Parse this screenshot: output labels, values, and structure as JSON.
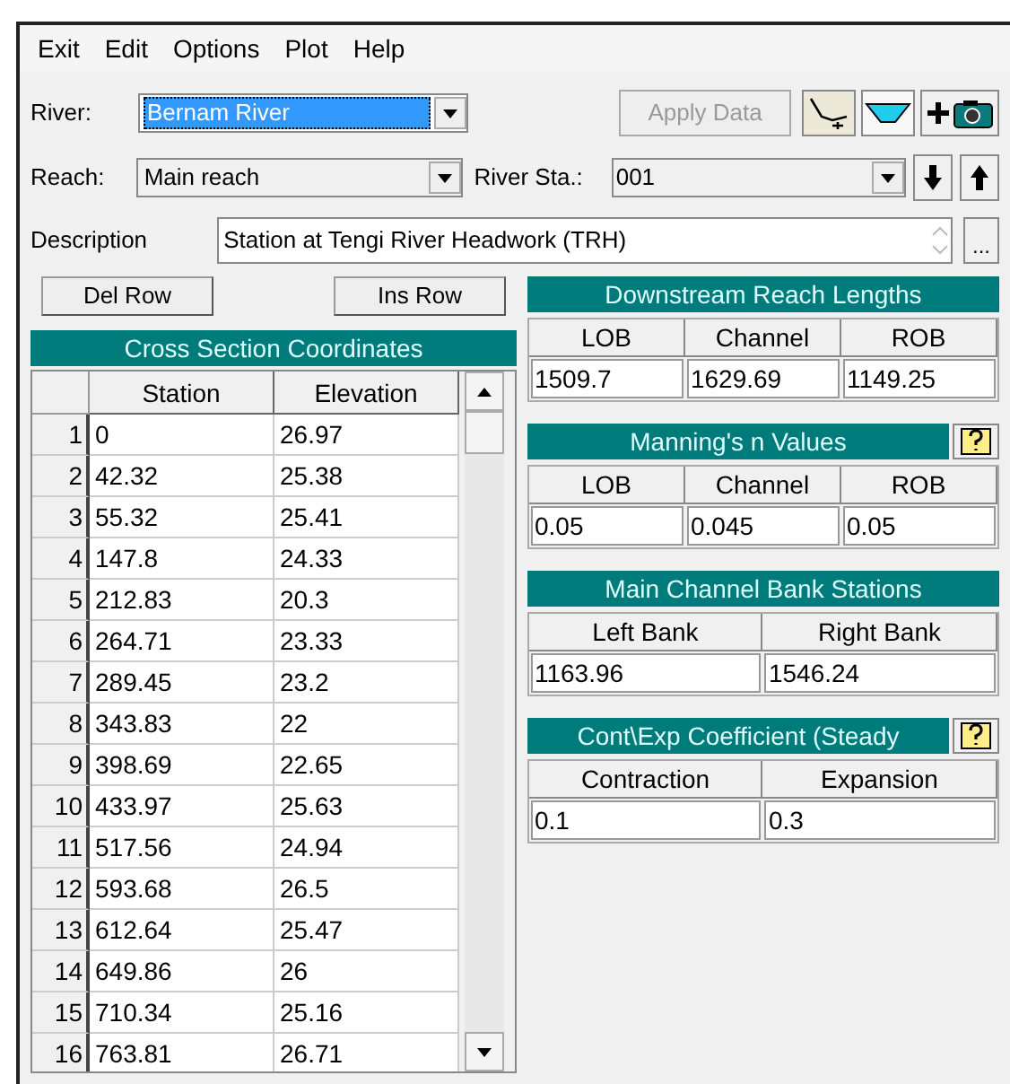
{
  "menu": [
    "Exit",
    "Edit",
    "Options",
    "Plot",
    "Help"
  ],
  "river": {
    "label": "River:",
    "value": "Bernam River"
  },
  "apply_button": {
    "label": "Apply Data",
    "disabled": true
  },
  "reach": {
    "label": "Reach:",
    "value": "Main reach"
  },
  "river_station": {
    "label": "River Sta.:",
    "value": "001"
  },
  "description": {
    "label": "Description",
    "value": "Station at Tengi River Headwork (TRH)",
    "more_button": "..."
  },
  "del_row": "Del Row",
  "ins_row": "Ins Row",
  "coordinates": {
    "title": "Cross Section Coordinates",
    "columns": [
      "Station",
      "Elevation"
    ],
    "rows": [
      {
        "n": "1",
        "station": "0",
        "elevation": "26.97"
      },
      {
        "n": "2",
        "station": "42.32",
        "elevation": "25.38"
      },
      {
        "n": "3",
        "station": "55.32",
        "elevation": "25.41"
      },
      {
        "n": "4",
        "station": "147.8",
        "elevation": "24.33"
      },
      {
        "n": "5",
        "station": "212.83",
        "elevation": "20.3"
      },
      {
        "n": "6",
        "station": "264.71",
        "elevation": "23.33"
      },
      {
        "n": "7",
        "station": "289.45",
        "elevation": "23.2"
      },
      {
        "n": "8",
        "station": "343.83",
        "elevation": "22"
      },
      {
        "n": "9",
        "station": "398.69",
        "elevation": "22.65"
      },
      {
        "n": "10",
        "station": "433.97",
        "elevation": "25.63"
      },
      {
        "n": "11",
        "station": "517.56",
        "elevation": "24.94"
      },
      {
        "n": "12",
        "station": "593.68",
        "elevation": "26.5"
      },
      {
        "n": "13",
        "station": "612.64",
        "elevation": "25.47"
      },
      {
        "n": "14",
        "station": "649.86",
        "elevation": "26"
      },
      {
        "n": "15",
        "station": "710.34",
        "elevation": "25.16"
      },
      {
        "n": "16",
        "station": "763.81",
        "elevation": "26.71"
      }
    ]
  },
  "panels": [
    {
      "title": "Downstream Reach Lengths",
      "help": false,
      "columns": [
        "LOB",
        "Channel",
        "ROB"
      ],
      "values": [
        "1509.7",
        "1629.69",
        "1149.25"
      ]
    },
    {
      "title": "Manning's n Values",
      "help": true,
      "columns": [
        "LOB",
        "Channel",
        "ROB"
      ],
      "values": [
        "0.05",
        "0.045",
        "0.05"
      ]
    },
    {
      "title": "Main Channel Bank Stations",
      "help": false,
      "columns": [
        "Left Bank",
        "Right Bank"
      ],
      "values": [
        "1163.96",
        "1546.24"
      ]
    },
    {
      "title": "Cont\\Exp Coefficient (Steady",
      "help": true,
      "columns": [
        "Contraction",
        "Expansion"
      ],
      "values": [
        "0.1",
        "0.3"
      ]
    }
  ]
}
